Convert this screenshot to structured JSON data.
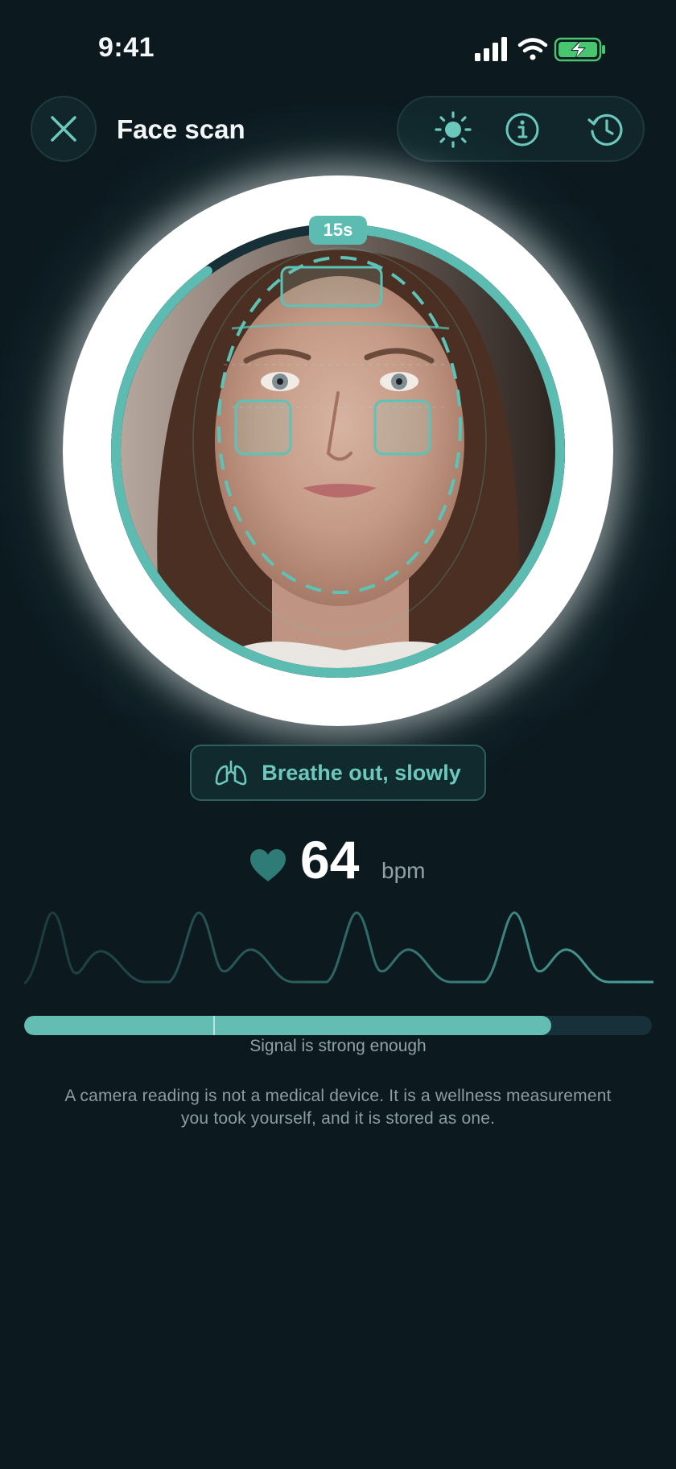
{
  "status_bar": {
    "time": "9:41"
  },
  "header": {
    "title": "Face scan"
  },
  "toolbar": {
    "icons": [
      "brightness-icon",
      "info-icon",
      "history-icon"
    ]
  },
  "scanner": {
    "timer": "15s",
    "progress": 0.9
  },
  "guidance": {
    "text": "Breathe out, slowly"
  },
  "heart_rate": {
    "value": "64",
    "unit": "bpm"
  },
  "signal": {
    "level": 0.84,
    "label": "Signal is strong enough"
  },
  "disclaimer": {
    "line1": "A camera reading is not a medical device. It is a wellness measurement",
    "line2": "you took yourself, and it is stored as one."
  },
  "colors": {
    "background": "#0c1a20",
    "accent": "#63bdb2",
    "text_primary": "#ffffff",
    "text_muted": "#8fa3a6"
  }
}
